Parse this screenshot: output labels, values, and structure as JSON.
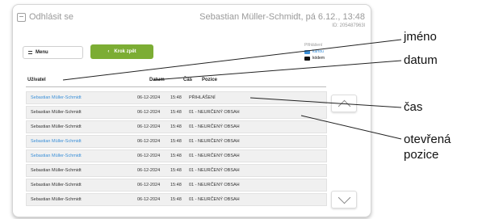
{
  "header": {
    "logout_label": "Odhlásit se",
    "user_line": "Sebastian Müller-Schmidt, pá 6.12., 13:48",
    "user_id": "ID: 205487963l"
  },
  "toolbar": {
    "menu_label": "Menu",
    "back_label": "Krok zpět"
  },
  "legend": {
    "title": "Přihlášení",
    "kartou": "kartou",
    "kodem": "kódem",
    "colors": {
      "kartou": "#3a8fd8",
      "kodem": "#111111"
    }
  },
  "table": {
    "columns": [
      "Uživatel",
      "Datum",
      "Čas",
      "Pozice"
    ],
    "rows": [
      {
        "name": "Sebastian Müller-Schmidt",
        "date": "06-12-2024",
        "time": "15:48",
        "position": "PŘIHLÁŠENÍ"
      },
      {
        "name": "Sebastian Müller-Schmidt",
        "date": "06-12-2024",
        "time": "15:48",
        "position": "01 - NEURČENÝ OBSAH"
      },
      {
        "name": "Sebastian Müller-Schmidt",
        "date": "06-12-2024",
        "time": "15:48",
        "position": "01 - NEURČENÝ OBSAH"
      },
      {
        "name": "Sebastian Müller-Schmidt",
        "date": "06-12-2024",
        "time": "15:48",
        "position": "01 - NEURČENÝ OBSAH"
      },
      {
        "name": "Sebastian Müller-Schmidt",
        "date": "06-12-2024",
        "time": "15:48",
        "position": "01 - NEURČENÝ OBSAH"
      },
      {
        "name": "Sebastian Müller-Schmidt",
        "date": "06-12-2024",
        "time": "15:48",
        "position": "01 - NEURČENÝ OBSAH"
      },
      {
        "name": "Sebastian Müller-Schmidt",
        "date": "06-12-2024",
        "time": "15:48",
        "position": "01 - NEURČENÝ OBSAH"
      },
      {
        "name": "Sebastian Müller-Schmidt",
        "date": "06-12-2024",
        "time": "15:48",
        "position": "01 - NEURČENÝ OBSAH"
      }
    ],
    "blue_rows": [
      0,
      3,
      4
    ]
  },
  "callouts": {
    "jmeno": "jméno",
    "datum": "datum",
    "cas": "čas",
    "pozice_line1": "otevřená",
    "pozice_line2": "pozice"
  },
  "icons": {
    "logout": "logout-icon",
    "menu": "hamburger-icon",
    "back": "chevron-left-icon",
    "scroll_up": "chevron-up-icon",
    "scroll_down": "chevron-down-icon"
  }
}
